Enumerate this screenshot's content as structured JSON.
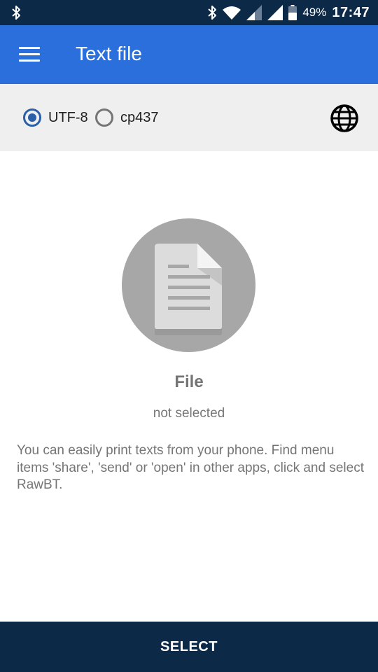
{
  "status_bar": {
    "battery_percent": "49%",
    "time": "17:47",
    "icons": [
      "bluetooth-icon",
      "bluetooth-icon",
      "wifi-icon",
      "signal-icon",
      "signal-icon",
      "battery-icon"
    ]
  },
  "app_bar": {
    "title": "Text file",
    "menu_icon": "menu-icon"
  },
  "encoding": {
    "options": [
      {
        "label": "UTF-8",
        "selected": true
      },
      {
        "label": "cp437",
        "selected": false
      }
    ],
    "language_icon": "globe-icon"
  },
  "file": {
    "icon": "document-icon",
    "title": "File",
    "status": "not selected"
  },
  "description": "You can easily print texts from your phone. Find menu items 'share', 'send' or 'open' in other apps, click and select RawBT.",
  "select_button": {
    "label": "SELECT"
  },
  "colors": {
    "status_bar": "#0c2948",
    "app_bar": "#2b6fdc",
    "encoding_bar": "#efefef",
    "radio_selected": "#2b5fa8",
    "select_button": "#0c2948",
    "muted_text": "#757575"
  }
}
